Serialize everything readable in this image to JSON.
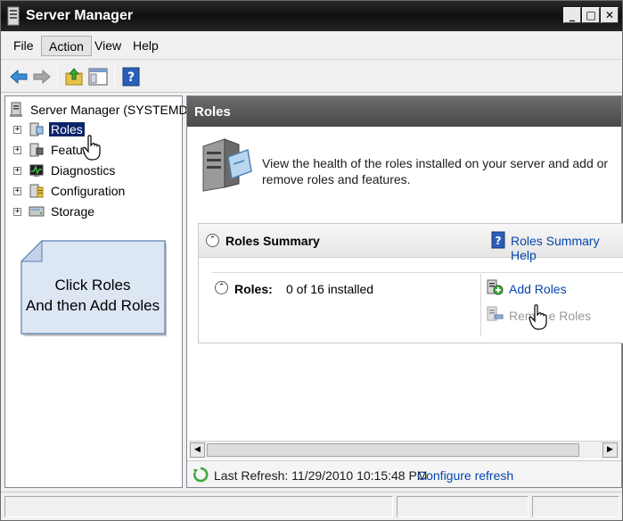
{
  "window": {
    "title": "Server Manager",
    "controls": {
      "minimize": "_",
      "maximize": "□",
      "close": "✕"
    }
  },
  "menu": [
    "File",
    "Action",
    "View",
    "Help"
  ],
  "toolbar": {
    "icons": [
      "back-arrow-icon",
      "forward-arrow-icon",
      "up-folder-icon",
      "show-hide-console-tree-icon",
      "help-icon"
    ]
  },
  "tree": {
    "root": "Server Manager (SYSTEMDC)",
    "items": [
      {
        "label": "Roles",
        "selected": true
      },
      {
        "label": "Featur"
      },
      {
        "label": "Diagnostics"
      },
      {
        "label": "Configuration"
      },
      {
        "label": "Storage"
      }
    ],
    "expander": "+"
  },
  "callout": {
    "line1": "Click Roles",
    "line2": "And then Add Roles",
    "color": "#dde6f3"
  },
  "main": {
    "header": "Roles",
    "intro": "View the health of the roles installed on your server and add or remove roles and features.",
    "summary": {
      "title": "Roles Summary",
      "help_link": "Roles Summary Help",
      "roles_label": "Roles:",
      "roles_value": "0 of 16 installed",
      "add_roles": "Add Roles",
      "remove_roles_part1": "Rem",
      "remove_roles_part2": "e Roles"
    },
    "refresh": {
      "text": "Last Refresh: 11/29/2010 10:15:48 PM",
      "link": "Configure refresh"
    }
  },
  "colors": {
    "link": "#0645ad",
    "titlebar": "#1a1a1a",
    "selection": "#0a246a",
    "header": "#555555"
  }
}
